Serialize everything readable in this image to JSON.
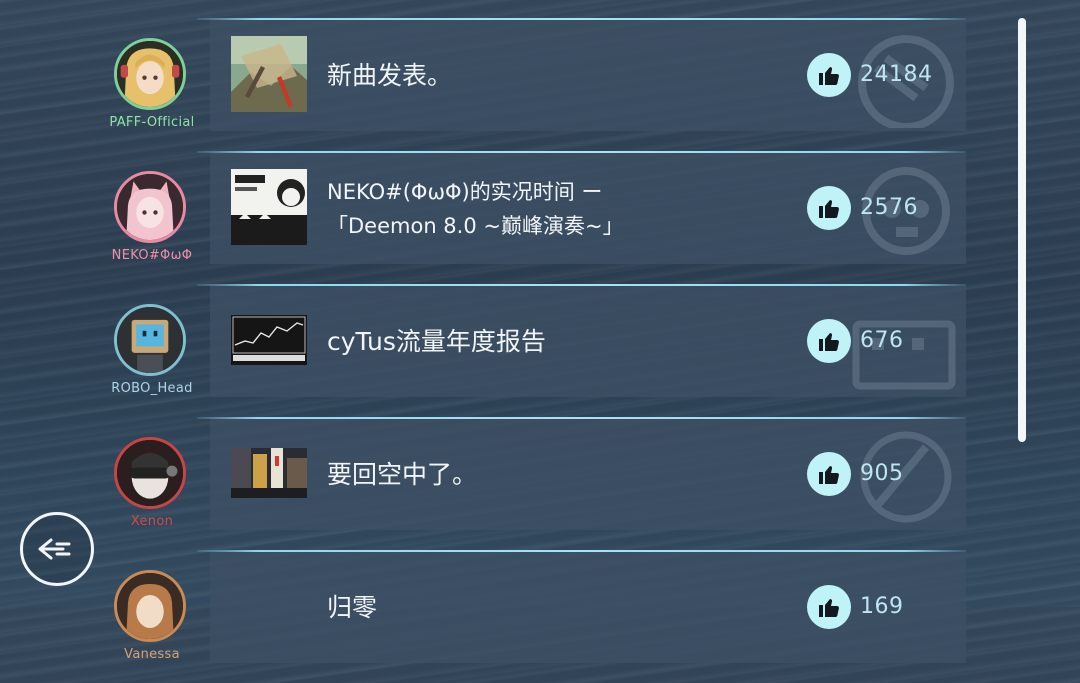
{
  "posts": [
    {
      "user": "PAFF-Official",
      "user_color": "#8fe3a6",
      "ring": "#7fcf9a",
      "title_lines": [
        "新曲发表。"
      ],
      "likes": "24184"
    },
    {
      "user": "NEKO#ΦωΦ",
      "user_color": "#f08fa8",
      "ring": "#e88aa2",
      "title_lines": [
        "NEKO#(ΦωΦ)的实况时间 ー",
        "「Deemon 8.0 ~巅峰演奏~」"
      ],
      "likes": "2576"
    },
    {
      "user": "ROBO_Head",
      "user_color": "#a9d7e6",
      "ring": "#7fbfd0",
      "title_lines": [
        "cyTus流量年度报告"
      ],
      "likes": "676"
    },
    {
      "user": "Xenon",
      "user_color": "#d24a4a",
      "ring": "#c84545",
      "title_lines": [
        "要回空中了。"
      ],
      "likes": "905"
    },
    {
      "user": "Vanessa",
      "user_color": "#d9a070",
      "ring": "#c98a55",
      "title_lines": [
        "归零"
      ],
      "likes": "169"
    }
  ],
  "icons": {
    "like": "thumbs-up-icon",
    "back": "back-arrow-icon"
  },
  "colors": {
    "accent": "#bff3f7",
    "divider": "#a6e3f4",
    "like_count": "#bde6f0"
  }
}
